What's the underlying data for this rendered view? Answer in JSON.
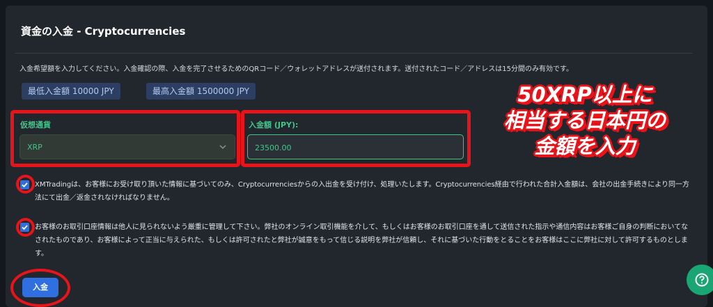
{
  "page": {
    "title": "資金の入金 - Cryptocurrencies",
    "instruction": "入金希望額を入力してください。入金確認の際、入金を完了させるためのQRコード／ウォレットアドレスが送付されます。送付されたコード／アドレスは15分間のみ有効です。"
  },
  "limits": {
    "min": "最低入金額 10000 JPY",
    "max": "最高入金額 1500000 JPY"
  },
  "form": {
    "currency_label": "仮想通貨",
    "currency_value": "XRP",
    "amount_label": "入金額 (JPY):",
    "amount_value": "23500.00"
  },
  "terms": {
    "term1": "XMTradingは、お客様にお受け取り頂いた情報に基づいてのみ、Cryptocurrenciesからの入出金を受け付け、処理いたします。Cryptocurrencies経由で行われた合計入金額は、会社の出金手続きにより同一方法にて出金／返金されなければなりません。",
    "term2": "お客様のお取引口座情報は他人に見られないよう厳重に管理して下さい。弊社のオンライン取引機能を介して、もしくはお客様のお取引口座を通して送信された指示や通信内容はお客様ご自身の判断においてなされたものであり、お客様によって正当に与えられた、もしくは許可されたと弊社が誠意をもって信じる説明を弊社が信頼し、それに基づいた行動をとることをお客様はここに弊社に対して許可するものとします。",
    "term1_checked": true,
    "term2_checked": true
  },
  "actions": {
    "deposit_label": "入金"
  },
  "annotation": {
    "line1": "50XRP以上に",
    "line2": "相当する日本円の",
    "line3": "金額を入力"
  },
  "colors": {
    "accent_green": "#3fc78a",
    "primary_blue": "#2f6fe0",
    "highlight_red": "#e8141a"
  }
}
